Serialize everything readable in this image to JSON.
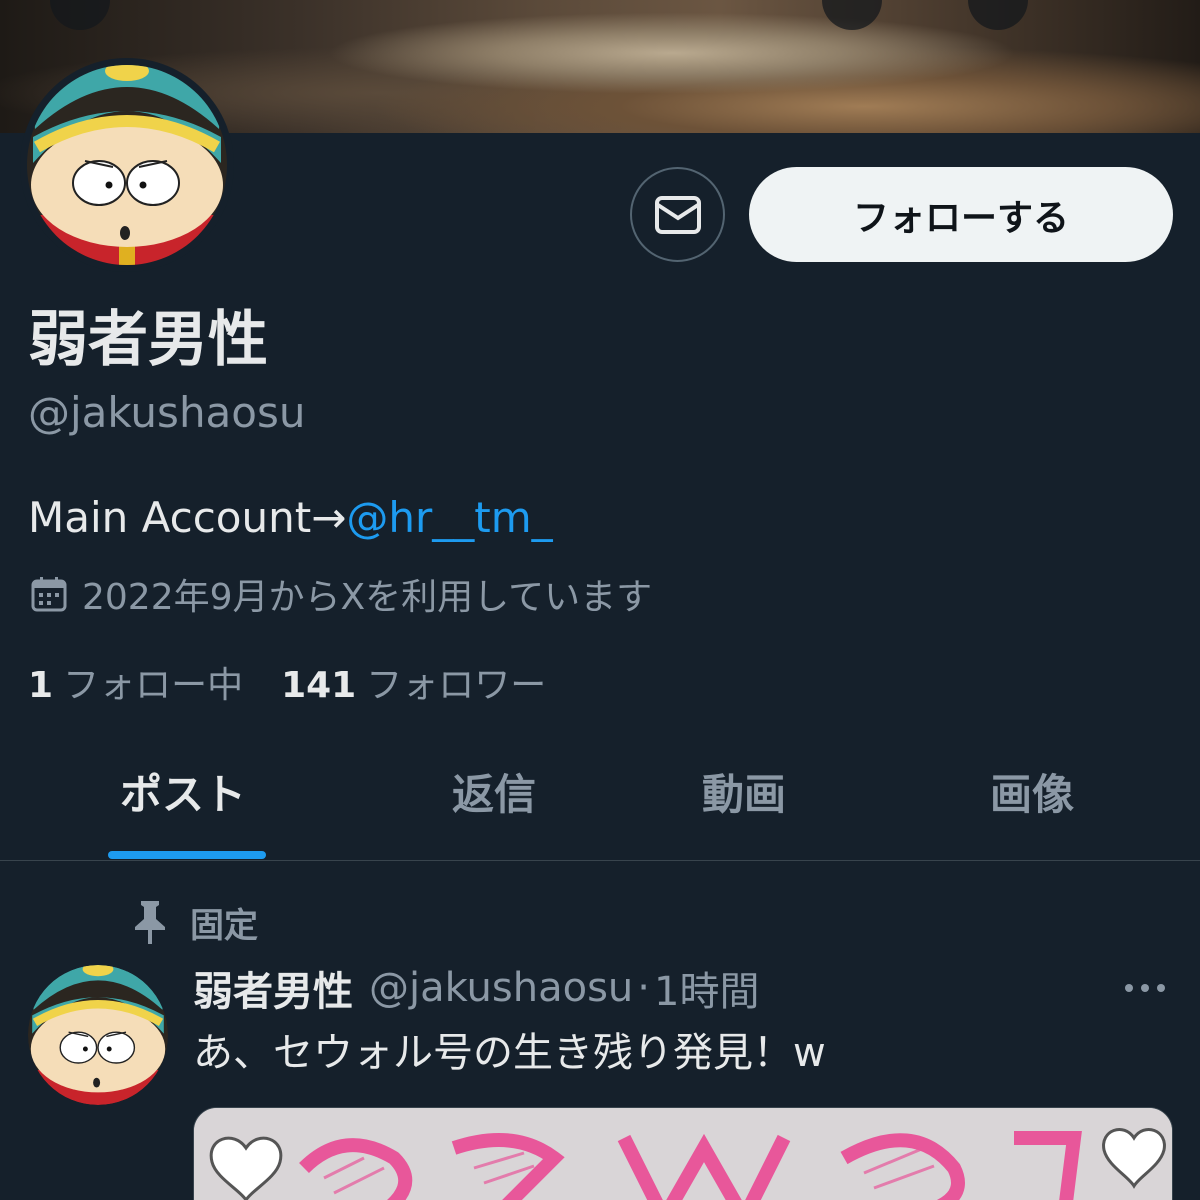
{
  "profile": {
    "display_name": "弱者男性",
    "handle": "@jakushaosu",
    "bio_prefix": "Main Account→",
    "bio_mention": "@hr__tm_",
    "joined": "2022年9月からXを利用しています",
    "following_count": "1",
    "following_label": "フォロー中",
    "followers_count": "141",
    "followers_label": "フォロワー"
  },
  "actions": {
    "follow_label": "フォローする",
    "dm_icon": "mail-icon"
  },
  "tabs": [
    {
      "label": "ポスト",
      "active": true
    },
    {
      "label": "返信",
      "active": false
    },
    {
      "label": "動画",
      "active": false
    },
    {
      "label": "画像",
      "active": false
    }
  ],
  "pinned_post": {
    "pinned_label": "固定",
    "author_name": "弱者男性",
    "author_handle": "@jakushaosu",
    "separator": "·",
    "time": "1時間",
    "text": "あ、セウォル号の生き残り発見！w"
  },
  "colors": {
    "background": "#15202b",
    "accent": "#1d9bf0",
    "muted": "#8b98a5",
    "text": "#e7e9ea"
  }
}
